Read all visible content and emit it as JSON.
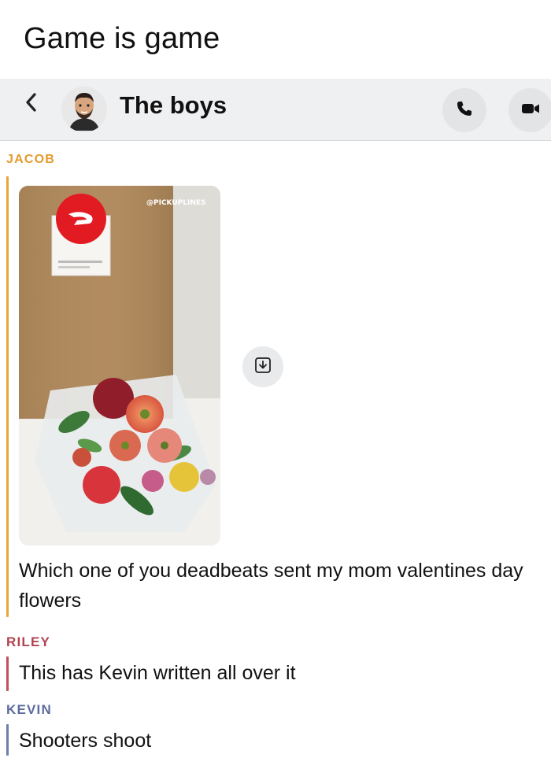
{
  "meme": {
    "title": "Game is game"
  },
  "header": {
    "chat_name": "The boys",
    "back_icon": "chevron-left-icon",
    "call_icon": "phone-icon",
    "video_icon": "video-camera-icon",
    "avatar_icon": "bitmoji-avatar"
  },
  "messages": [
    {
      "sender": "JACOB",
      "sender_color": "#e59a2c",
      "attachment": {
        "type": "image",
        "watermark": "@PICKUPLINES",
        "description_icon": "doordash-bag-with-flowers"
      },
      "text": "Which one of you deadbeats sent my mom valentines day flowers"
    },
    {
      "sender": "RILEY",
      "sender_color": "#b1434f",
      "text": "This has Kevin written all over it"
    },
    {
      "sender": "KEVIN",
      "sender_color": "#5c6c9d",
      "text": "Shooters shoot"
    }
  ],
  "actions": {
    "save_icon": "save-download-icon"
  }
}
